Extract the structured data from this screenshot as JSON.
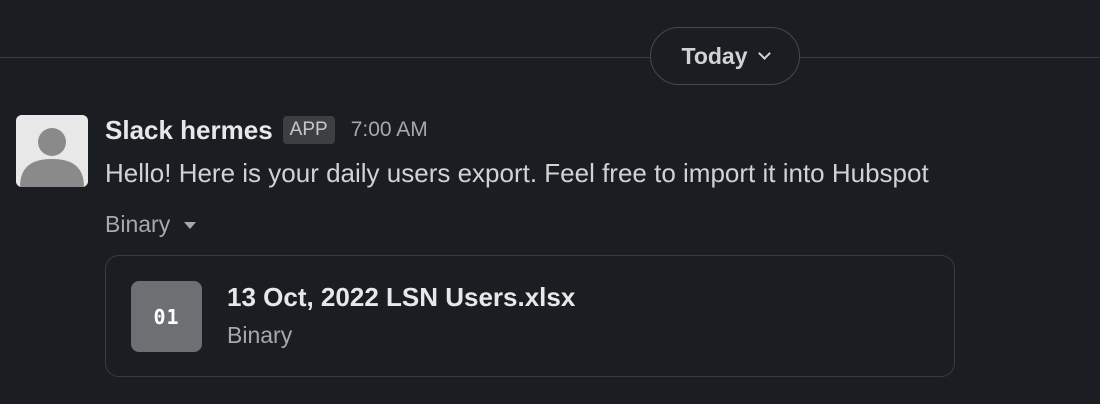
{
  "divider": {
    "date_label": "Today",
    "chevron_icon": "chevron-down-icon"
  },
  "message": {
    "avatar_icon": "default-user-avatar-icon",
    "sender": "Slack hermes",
    "badge": "APP",
    "time": "7:00 AM",
    "text": "Hello! Here is your daily users export. Feel free to import it into Hubspot",
    "attachment": {
      "toggle_label": "Binary",
      "toggle_icon": "caret-down-icon",
      "file": {
        "icon_label": "01",
        "icon": "binary-file-icon",
        "name": "13 Oct, 2022 LSN Users.xlsx",
        "type": "Binary"
      }
    }
  },
  "colors": {
    "background": "#1a1d21",
    "text_primary": "#d1d2d3",
    "text_secondary": "#a7a8aa",
    "border": "#3a3c40",
    "file_icon_bg": "#6e6f72"
  }
}
